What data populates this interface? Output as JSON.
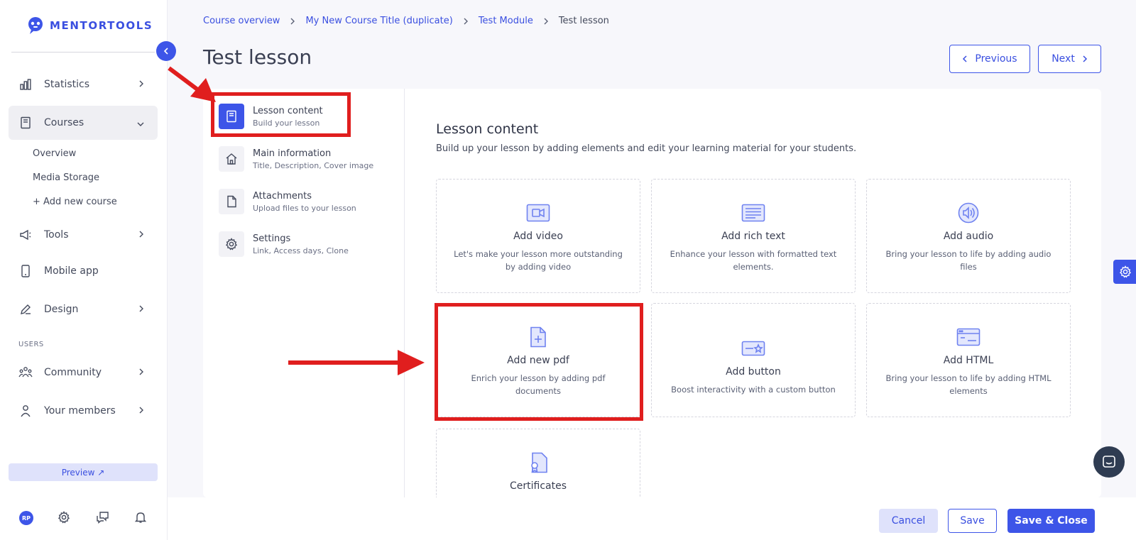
{
  "app": {
    "logo_text": "MENTORTOOLS"
  },
  "sidebar": {
    "items": [
      {
        "label": "Statistics",
        "icon": "bar-chart-icon"
      },
      {
        "label": "Courses",
        "icon": "book-icon"
      },
      {
        "label": "Tools",
        "icon": "megaphone-icon"
      },
      {
        "label": "Mobile app",
        "icon": "phone-icon"
      },
      {
        "label": "Design",
        "icon": "pencil-icon"
      },
      {
        "label": "Community",
        "icon": "people-icon"
      },
      {
        "label": "Your members",
        "icon": "user-icon"
      }
    ],
    "course_sub_items": [
      "Overview",
      "Media Storage",
      "+ Add new course"
    ],
    "section_users": "USERS",
    "preview_label": "Preview ↗",
    "avatar_initials": "RP"
  },
  "breadcrumb": [
    "Course overview",
    "My New Course Title (duplicate)",
    "Test Module",
    "Test lesson"
  ],
  "page": {
    "title": "Test lesson",
    "previous_label": "Previous",
    "next_label": "Next"
  },
  "lesson_menu": [
    {
      "title": "Lesson content",
      "sub": "Build your lesson",
      "icon": "book-icon",
      "active": true
    },
    {
      "title": "Main information",
      "sub": "Title, Description, Cover image",
      "icon": "home-icon"
    },
    {
      "title": "Attachments",
      "sub": "Upload files to your lesson",
      "icon": "file-icon"
    },
    {
      "title": "Settings",
      "sub": "Link, Access days, Clone",
      "icon": "gear-icon"
    }
  ],
  "content": {
    "title": "Lesson content",
    "subtitle": "Build up your lesson by adding elements and edit your learning material for your students.",
    "cards": [
      {
        "title": "Add video",
        "desc": "Let's make your lesson more outstanding by adding video",
        "icon": "video-icon"
      },
      {
        "title": "Add rich text",
        "desc": "Enhance your lesson with formatted text elements.",
        "icon": "text-icon"
      },
      {
        "title": "Add audio",
        "desc": "Bring your lesson to life by adding audio files",
        "icon": "audio-icon"
      },
      {
        "title": "Add new pdf",
        "desc": "Enrich your lesson by adding pdf documents",
        "icon": "pdf-icon"
      },
      {
        "title": "Add button",
        "desc": "Boost interactivity with a custom button",
        "icon": "button-icon"
      },
      {
        "title": "Add HTML",
        "desc": "Bring your lesson to life by adding HTML elements",
        "icon": "html-icon"
      },
      {
        "title": "Certificates",
        "desc": "",
        "icon": "certificate-icon"
      }
    ]
  },
  "footer": {
    "cancel_label": "Cancel",
    "save_label": "Save",
    "save_close_label": "Save & Close"
  },
  "colors": {
    "accent": "#3d55e8",
    "annotation_red": "#e01e1e"
  }
}
